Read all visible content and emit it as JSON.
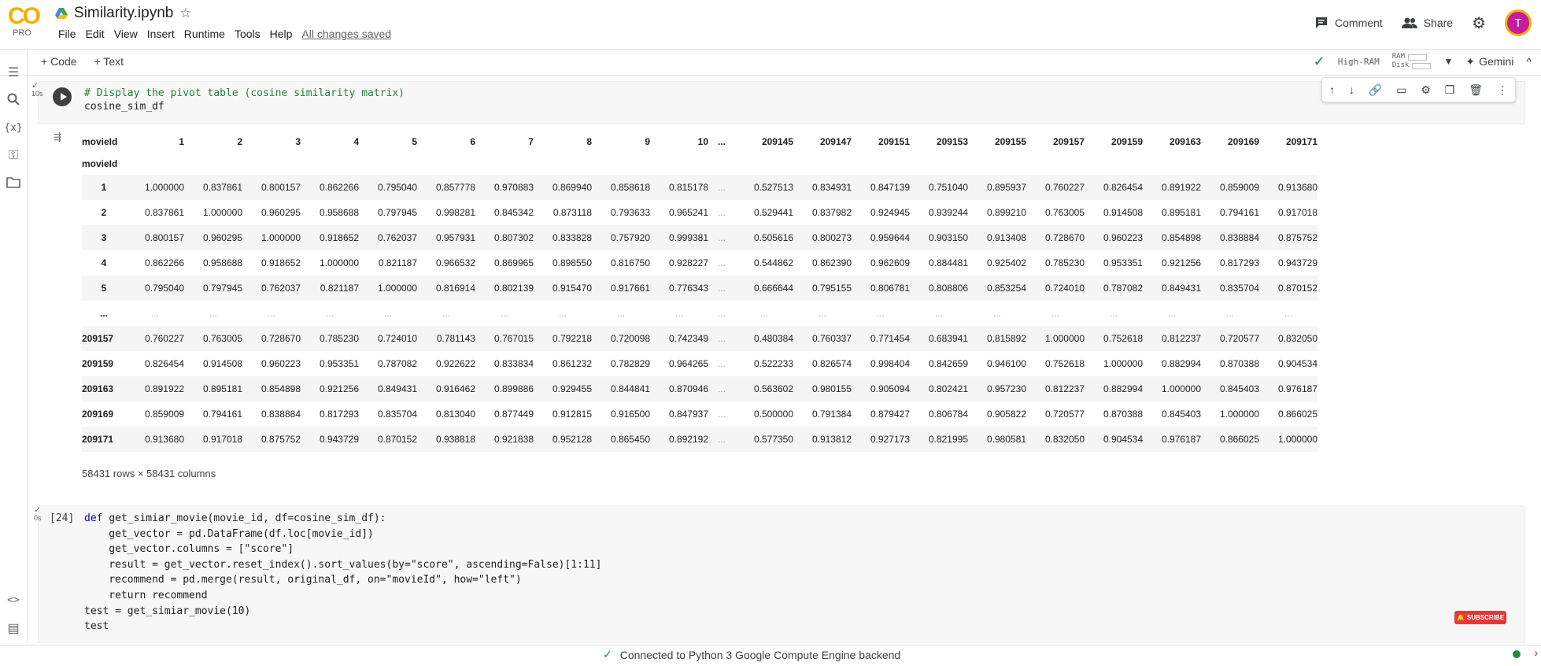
{
  "header": {
    "logo_text": "CO",
    "logo_sub": "PRO",
    "title": "Similarity.ipynb",
    "menu": [
      "File",
      "Edit",
      "View",
      "Insert",
      "Runtime",
      "Tools",
      "Help"
    ],
    "saved_status": "All changes saved",
    "comment_label": "Comment",
    "share_label": "Share",
    "avatar_letter": "T"
  },
  "toolbar": {
    "add_code": "+ Code",
    "add_text": "+ Text",
    "runtime_type": "High-RAM",
    "ram_label": "RAM",
    "disk_label": "Disk",
    "gemini_label": "Gemini"
  },
  "cell1": {
    "exec_time": "10s",
    "code": [
      "# Display the pivot table (cosine similarity matrix)",
      "cosine_sim_df"
    ]
  },
  "dataframe": {
    "index_name": "movieId",
    "columns_label": "movieId",
    "columns": [
      "1",
      "2",
      "3",
      "4",
      "5",
      "6",
      "7",
      "8",
      "9",
      "10",
      "...",
      "209145",
      "209147",
      "209151",
      "209153",
      "209155",
      "209157",
      "209159",
      "209163",
      "209169",
      "209171"
    ],
    "rows": [
      {
        "id": "1",
        "values": [
          "1.000000",
          "0.837861",
          "0.800157",
          "0.862266",
          "0.795040",
          "0.857778",
          "0.970883",
          "0.869940",
          "0.858618",
          "0.815178",
          "...",
          "0.527513",
          "0.834931",
          "0.847139",
          "0.751040",
          "0.895937",
          "0.760227",
          "0.826454",
          "0.891922",
          "0.859009",
          "0.913680"
        ]
      },
      {
        "id": "2",
        "values": [
          "0.837861",
          "1.000000",
          "0.960295",
          "0.958688",
          "0.797945",
          "0.998281",
          "0.845342",
          "0.873118",
          "0.793633",
          "0.965241",
          "...",
          "0.529441",
          "0.837982",
          "0.924945",
          "0.939244",
          "0.899210",
          "0.763005",
          "0.914508",
          "0.895181",
          "0.794161",
          "0.917018"
        ]
      },
      {
        "id": "3",
        "values": [
          "0.800157",
          "0.960295",
          "1.000000",
          "0.918652",
          "0.762037",
          "0.957931",
          "0.807302",
          "0.833828",
          "0.757920",
          "0.999381",
          "...",
          "0.505616",
          "0.800273",
          "0.959644",
          "0.903150",
          "0.913408",
          "0.728670",
          "0.960223",
          "0.854898",
          "0.838884",
          "0.875752"
        ]
      },
      {
        "id": "4",
        "values": [
          "0.862266",
          "0.958688",
          "0.918652",
          "1.000000",
          "0.821187",
          "0.966532",
          "0.869965",
          "0.898550",
          "0.816750",
          "0.928227",
          "...",
          "0.544862",
          "0.862390",
          "0.962609",
          "0.884481",
          "0.925402",
          "0.785230",
          "0.953351",
          "0.921256",
          "0.817293",
          "0.943729"
        ]
      },
      {
        "id": "5",
        "values": [
          "0.795040",
          "0.797945",
          "0.762037",
          "0.821187",
          "1.000000",
          "0.816914",
          "0.802139",
          "0.915470",
          "0.917661",
          "0.776343",
          "...",
          "0.666644",
          "0.795155",
          "0.806781",
          "0.808806",
          "0.853254",
          "0.724010",
          "0.787082",
          "0.849431",
          "0.835704",
          "0.870152"
        ]
      },
      {
        "id": "...",
        "values": [
          "...",
          "...",
          "...",
          "...",
          "...",
          "...",
          "...",
          "...",
          "...",
          "...",
          "...",
          "...",
          "...",
          "...",
          "...",
          "...",
          "...",
          "...",
          "...",
          "...",
          "..."
        ]
      },
      {
        "id": "209157",
        "values": [
          "0.760227",
          "0.763005",
          "0.728670",
          "0.785230",
          "0.724010",
          "0.781143",
          "0.767015",
          "0.792218",
          "0.720098",
          "0.742349",
          "...",
          "0.480384",
          "0.760337",
          "0.771454",
          "0.683941",
          "0.815892",
          "1.000000",
          "0.752618",
          "0.812237",
          "0.720577",
          "0.832050"
        ]
      },
      {
        "id": "209159",
        "values": [
          "0.826454",
          "0.914508",
          "0.960223",
          "0.953351",
          "0.787082",
          "0.922622",
          "0.833834",
          "0.861232",
          "0.782829",
          "0.964265",
          "...",
          "0.522233",
          "0.826574",
          "0.998404",
          "0.842659",
          "0.946100",
          "0.752618",
          "1.000000",
          "0.882994",
          "0.870388",
          "0.904534"
        ]
      },
      {
        "id": "209163",
        "values": [
          "0.891922",
          "0.895181",
          "0.854898",
          "0.921256",
          "0.849431",
          "0.916462",
          "0.899886",
          "0.929455",
          "0.844841",
          "0.870946",
          "...",
          "0.563602",
          "0.980155",
          "0.905094",
          "0.802421",
          "0.957230",
          "0.812237",
          "0.882994",
          "1.000000",
          "0.845403",
          "0.976187"
        ]
      },
      {
        "id": "209169",
        "values": [
          "0.859009",
          "0.794161",
          "0.838884",
          "0.817293",
          "0.835704",
          "0.813040",
          "0.877449",
          "0.912815",
          "0.916500",
          "0.847937",
          "...",
          "0.500000",
          "0.791384",
          "0.879427",
          "0.806784",
          "0.905822",
          "0.720577",
          "0.870388",
          "0.845403",
          "1.000000",
          "0.866025"
        ]
      },
      {
        "id": "209171",
        "values": [
          "0.913680",
          "0.917018",
          "0.875752",
          "0.943729",
          "0.870152",
          "0.938818",
          "0.921838",
          "0.952128",
          "0.865450",
          "0.892192",
          "...",
          "0.577350",
          "0.913812",
          "0.927173",
          "0.821995",
          "0.980581",
          "0.832050",
          "0.904534",
          "0.976187",
          "0.866025",
          "1.000000"
        ]
      }
    ],
    "shape_note": "58431 rows × 58431 columns"
  },
  "cell2": {
    "exec_count": "[24]",
    "exec_time": "0s",
    "code": [
      "def get_simiar_movie(movie_id, df=cosine_sim_df):",
      "    get_vector = pd.DataFrame(df.loc[movie_id])",
      "    get_vector.columns = [\"score\"]",
      "    result = get_vector.reset_index().sort_values(by=\"score\", ascending=False)[1:11]",
      "    recommend = pd.merge(result, original_df, on=\"movieId\", how=\"left\")",
      "    return recommend",
      "test = get_simiar_movie(10)",
      "test"
    ]
  },
  "overlay": {
    "subscribe_label": "SUBSCRIBE"
  },
  "status": {
    "text": "Connected to Python 3 Google Compute Engine backend"
  }
}
